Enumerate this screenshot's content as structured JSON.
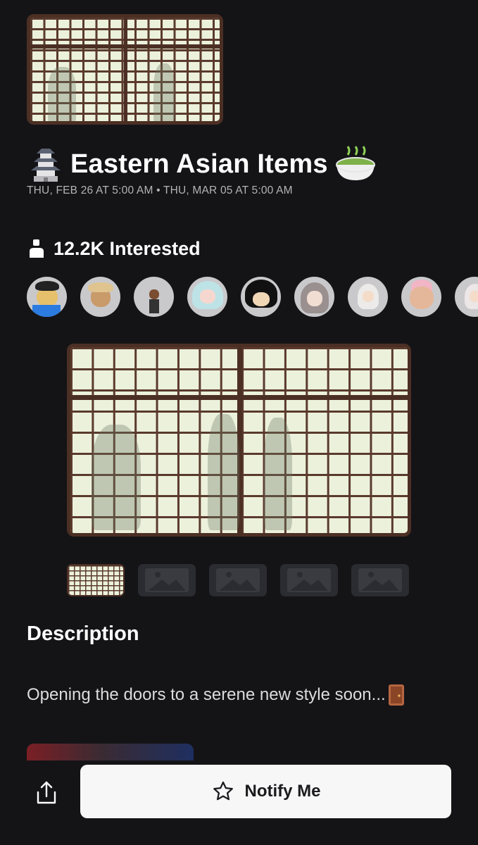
{
  "event": {
    "title": "Eastern Asian Items",
    "dates": "THU, FEB 26 AT 5:00 AM • THU, MAR 05 AT 5:00 AM",
    "interested": "12.2K Interested"
  },
  "icons": {
    "title_left": "japanese-castle-emoji",
    "title_right": "green-tea-emoji",
    "interested": "person-icon",
    "description_end": "door-emoji",
    "share": "share-icon",
    "notify": "star-icon"
  },
  "avatars_count_visible": 9,
  "gallery": {
    "thumbnails": [
      "shoji-image",
      "placeholder-image",
      "placeholder-image",
      "placeholder-image",
      "placeholder-image"
    ],
    "selected_index": 0
  },
  "description": {
    "heading": "Description",
    "text": "Opening the doors to a serene new style soon..."
  },
  "actions": {
    "notify_label": "Notify Me"
  },
  "colors": {
    "background": "#141417",
    "button": "#f7f7f8",
    "shoji_paper": "#ecf1dc",
    "shoji_frame": "#4c2f24"
  }
}
